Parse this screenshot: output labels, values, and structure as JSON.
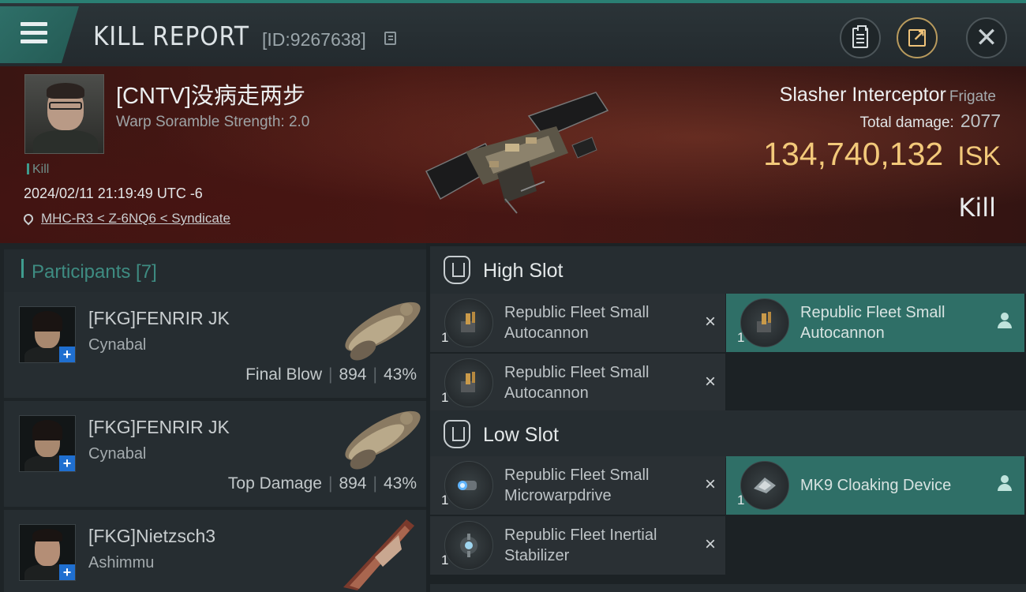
{
  "header": {
    "title": "KILL REPORT",
    "report_id": "[ID:9267638]"
  },
  "victim": {
    "name": "[CNTV]没病走两步",
    "scramble": "Warp Soramble Strength: 2.0",
    "tag": "Kill",
    "timestamp": "2024/02/11 21:19:49 UTC -6",
    "location": "MHC-R3 < Z-6NQ6 < Syndicate",
    "ship": "Slasher Interceptor",
    "ship_class": "Frigate",
    "total_damage_label": "Total damage:",
    "total_damage": "2077",
    "isk_value": "134,740,132",
    "isk_unit": "ISK",
    "result": "Kill"
  },
  "participants": {
    "header": "Participants [7]",
    "rows": [
      {
        "name": "[FKG]FENRIR JK",
        "ship": "Cynabal",
        "role": "Final Blow",
        "damage": "894",
        "percent": "43%"
      },
      {
        "name": "[FKG]FENRIR JK",
        "ship": "Cynabal",
        "role": "Top Damage",
        "damage": "894",
        "percent": "43%"
      },
      {
        "name": "[FKG]Nietzsch3",
        "ship": "Ashimmu"
      }
    ]
  },
  "fitting": {
    "high_slot_label": "High Slot",
    "low_slot_label": "Low Slot",
    "high": [
      {
        "qty": "1",
        "name": "Republic Fleet Small Autocannon",
        "status": "destroyed",
        "icon": "autocannon-icon"
      },
      {
        "qty": "1",
        "name": "Republic Fleet Small Autocannon",
        "status": "dropped",
        "icon": "autocannon-icon"
      },
      {
        "qty": "1",
        "name": "Republic Fleet Small Autocannon",
        "status": "destroyed",
        "icon": "autocannon-icon"
      }
    ],
    "low": [
      {
        "qty": "1",
        "name": "Republic Fleet Small Microwarpdrive",
        "status": "destroyed",
        "icon": "microwarpdrive-icon"
      },
      {
        "qty": "1",
        "name": "MK9 Cloaking Device",
        "status": "dropped",
        "icon": "cloaking-device-icon"
      },
      {
        "qty": "1",
        "name": "Republic Fleet Inertial Stabilizer",
        "status": "destroyed",
        "icon": "inertial-stabilizer-icon"
      }
    ]
  },
  "icons": {
    "status_destroyed": "×"
  },
  "colors": {
    "accent": "#2f6f67",
    "isk": "#f3c97a",
    "header_bar": "#2a7f73",
    "banner": "#4a1a15"
  }
}
